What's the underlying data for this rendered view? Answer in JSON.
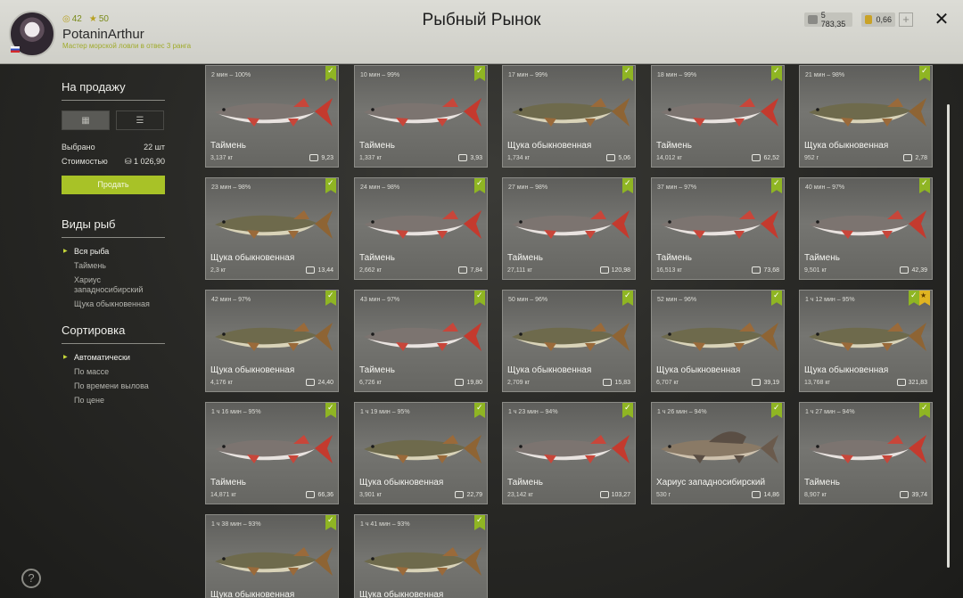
{
  "header": {
    "title": "Рыбный Рынок",
    "level": "42",
    "stars": "50",
    "username": "PotaninArthur",
    "rank": "Мастер морской ловли в отвес 3 ранга",
    "silver": "5 783,35",
    "gold": "0,66",
    "plus_label": "+",
    "close_label": "✕"
  },
  "sidebar": {
    "for_sale_title": "На продажу",
    "selected_label": "Выбрано",
    "selected_value": "22 шт",
    "cost_label": "Стоимостью",
    "cost_value": "1 026,90",
    "sell_button": "Продать",
    "species_title": "Виды рыб",
    "species": [
      {
        "label": "Вся рыба",
        "active": true
      },
      {
        "label": "Таймень",
        "active": false
      },
      {
        "label": "Хариус западносибирский",
        "active": false
      },
      {
        "label": "Щука обыкновенная",
        "active": false
      }
    ],
    "sort_title": "Сортировка",
    "sort": [
      {
        "label": "Автоматически",
        "active": true
      },
      {
        "label": "По массе",
        "active": false
      },
      {
        "label": "По времени вылова",
        "active": false
      },
      {
        "label": "По цене",
        "active": false
      }
    ],
    "help_label": "?"
  },
  "fish_cards": [
    {
      "time": "2 мин – 100%",
      "name": "Таймень",
      "weight": "3,137 кг",
      "price": "9,23",
      "type": "taimen",
      "star": false
    },
    {
      "time": "10 мин – 99%",
      "name": "Таймень",
      "weight": "1,337 кг",
      "price": "3,93",
      "type": "taimen",
      "star": false
    },
    {
      "time": "17 мин – 99%",
      "name": "Щука обыкновенная",
      "weight": "1,734 кг",
      "price": "5,06",
      "type": "pike",
      "star": false
    },
    {
      "time": "18 мин – 99%",
      "name": "Таймень",
      "weight": "14,012 кг",
      "price": "62,52",
      "type": "taimen",
      "star": false
    },
    {
      "time": "21 мин – 98%",
      "name": "Щука обыкновенная",
      "weight": "952 г",
      "price": "2,78",
      "type": "pike",
      "star": false
    },
    {
      "time": "23 мин – 98%",
      "name": "Щука обыкновенная",
      "weight": "2,3 кг",
      "price": "13,44",
      "type": "pike",
      "star": false
    },
    {
      "time": "24 мин – 98%",
      "name": "Таймень",
      "weight": "2,662 кг",
      "price": "7,84",
      "type": "taimen",
      "star": false
    },
    {
      "time": "27 мин – 98%",
      "name": "Таймень",
      "weight": "27,111 кг",
      "price": "120,98",
      "type": "taimen",
      "star": false
    },
    {
      "time": "37 мин – 97%",
      "name": "Таймень",
      "weight": "16,513 кг",
      "price": "73,68",
      "type": "taimen",
      "star": false
    },
    {
      "time": "40 мин – 97%",
      "name": "Таймень",
      "weight": "9,501 кг",
      "price": "42,39",
      "type": "taimen",
      "star": false
    },
    {
      "time": "42 мин – 97%",
      "name": "Щука обыкновенная",
      "weight": "4,176 кг",
      "price": "24,40",
      "type": "pike",
      "star": false
    },
    {
      "time": "43 мин – 97%",
      "name": "Таймень",
      "weight": "6,726 кг",
      "price": "19,80",
      "type": "taimen",
      "star": false
    },
    {
      "time": "50 мин – 96%",
      "name": "Щука обыкновенная",
      "weight": "2,709 кг",
      "price": "15,83",
      "type": "pike",
      "star": false
    },
    {
      "time": "52 мин – 96%",
      "name": "Щука обыкновенная",
      "weight": "6,707 кг",
      "price": "39,19",
      "type": "pike",
      "star": false
    },
    {
      "time": "1 ч 12 мин – 95%",
      "name": "Щука обыкновенная",
      "weight": "13,768 кг",
      "price": "321,83",
      "type": "pike",
      "star": true
    },
    {
      "time": "1 ч 16 мин – 95%",
      "name": "Таймень",
      "weight": "14,871 кг",
      "price": "66,36",
      "type": "taimen",
      "star": false
    },
    {
      "time": "1 ч 19 мин – 95%",
      "name": "Щука обыкновенная",
      "weight": "3,901 кг",
      "price": "22,79",
      "type": "pike",
      "star": false
    },
    {
      "time": "1 ч 23 мин – 94%",
      "name": "Таймень",
      "weight": "23,142 кг",
      "price": "103,27",
      "type": "taimen",
      "star": false
    },
    {
      "time": "1 ч 26 мин – 94%",
      "name": "Хариус западносибирский",
      "weight": "530 г",
      "price": "14,86",
      "type": "grayling",
      "star": false
    },
    {
      "time": "1 ч 27 мин – 94%",
      "name": "Таймень",
      "weight": "8,907 кг",
      "price": "39,74",
      "type": "taimen",
      "star": false
    },
    {
      "time": "1 ч 38 мин – 93%",
      "name": "Щука обыкновенная",
      "weight": "",
      "price": "",
      "type": "pike",
      "star": false
    },
    {
      "time": "1 ч 41 мин – 93%",
      "name": "Щука обыкновенная",
      "weight": "",
      "price": "",
      "type": "pike",
      "star": false
    }
  ],
  "colors": {
    "accent": "#a8c227",
    "check_badge": "#8fb523",
    "star_badge": "#e0b421"
  }
}
